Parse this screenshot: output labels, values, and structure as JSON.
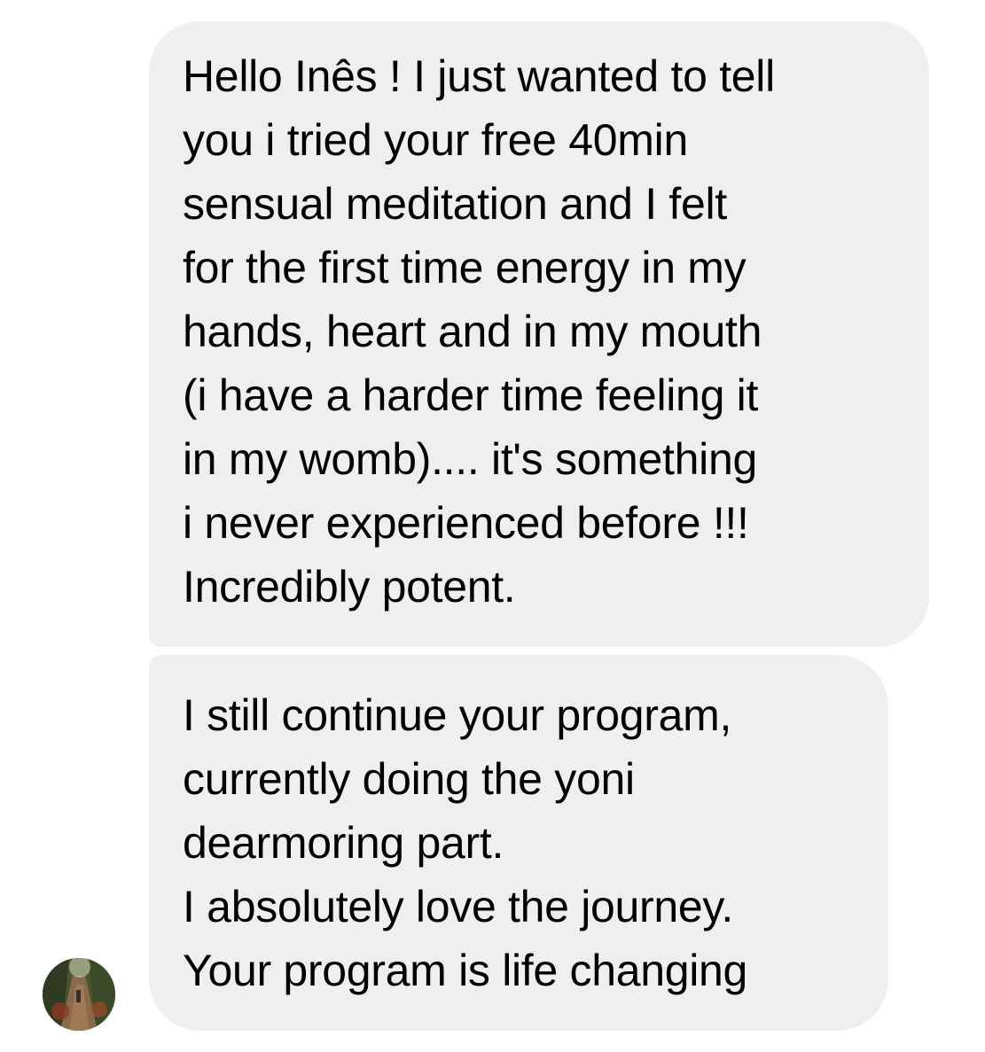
{
  "conversation": {
    "messages": [
      {
        "sender": "contact",
        "text": "Hello Inês ! I just wanted to tell\nyou i tried your free 40min\nsensual meditation and I felt\nfor the first time energy in my\nhands, heart and in my mouth\n(i have a harder time feeling it\nin my womb).... it's something\ni never experienced before !!!\nIncredibly potent."
      },
      {
        "sender": "contact",
        "text": "I still continue your program,\ncurrently doing the yoni\ndearmoring part.\nI absolutely love the journey.\nYour program is life changing"
      }
    ],
    "avatar_icon": "contact-avatar-photo",
    "bubble_color": "#efefef",
    "background_color": "#ffffff"
  }
}
